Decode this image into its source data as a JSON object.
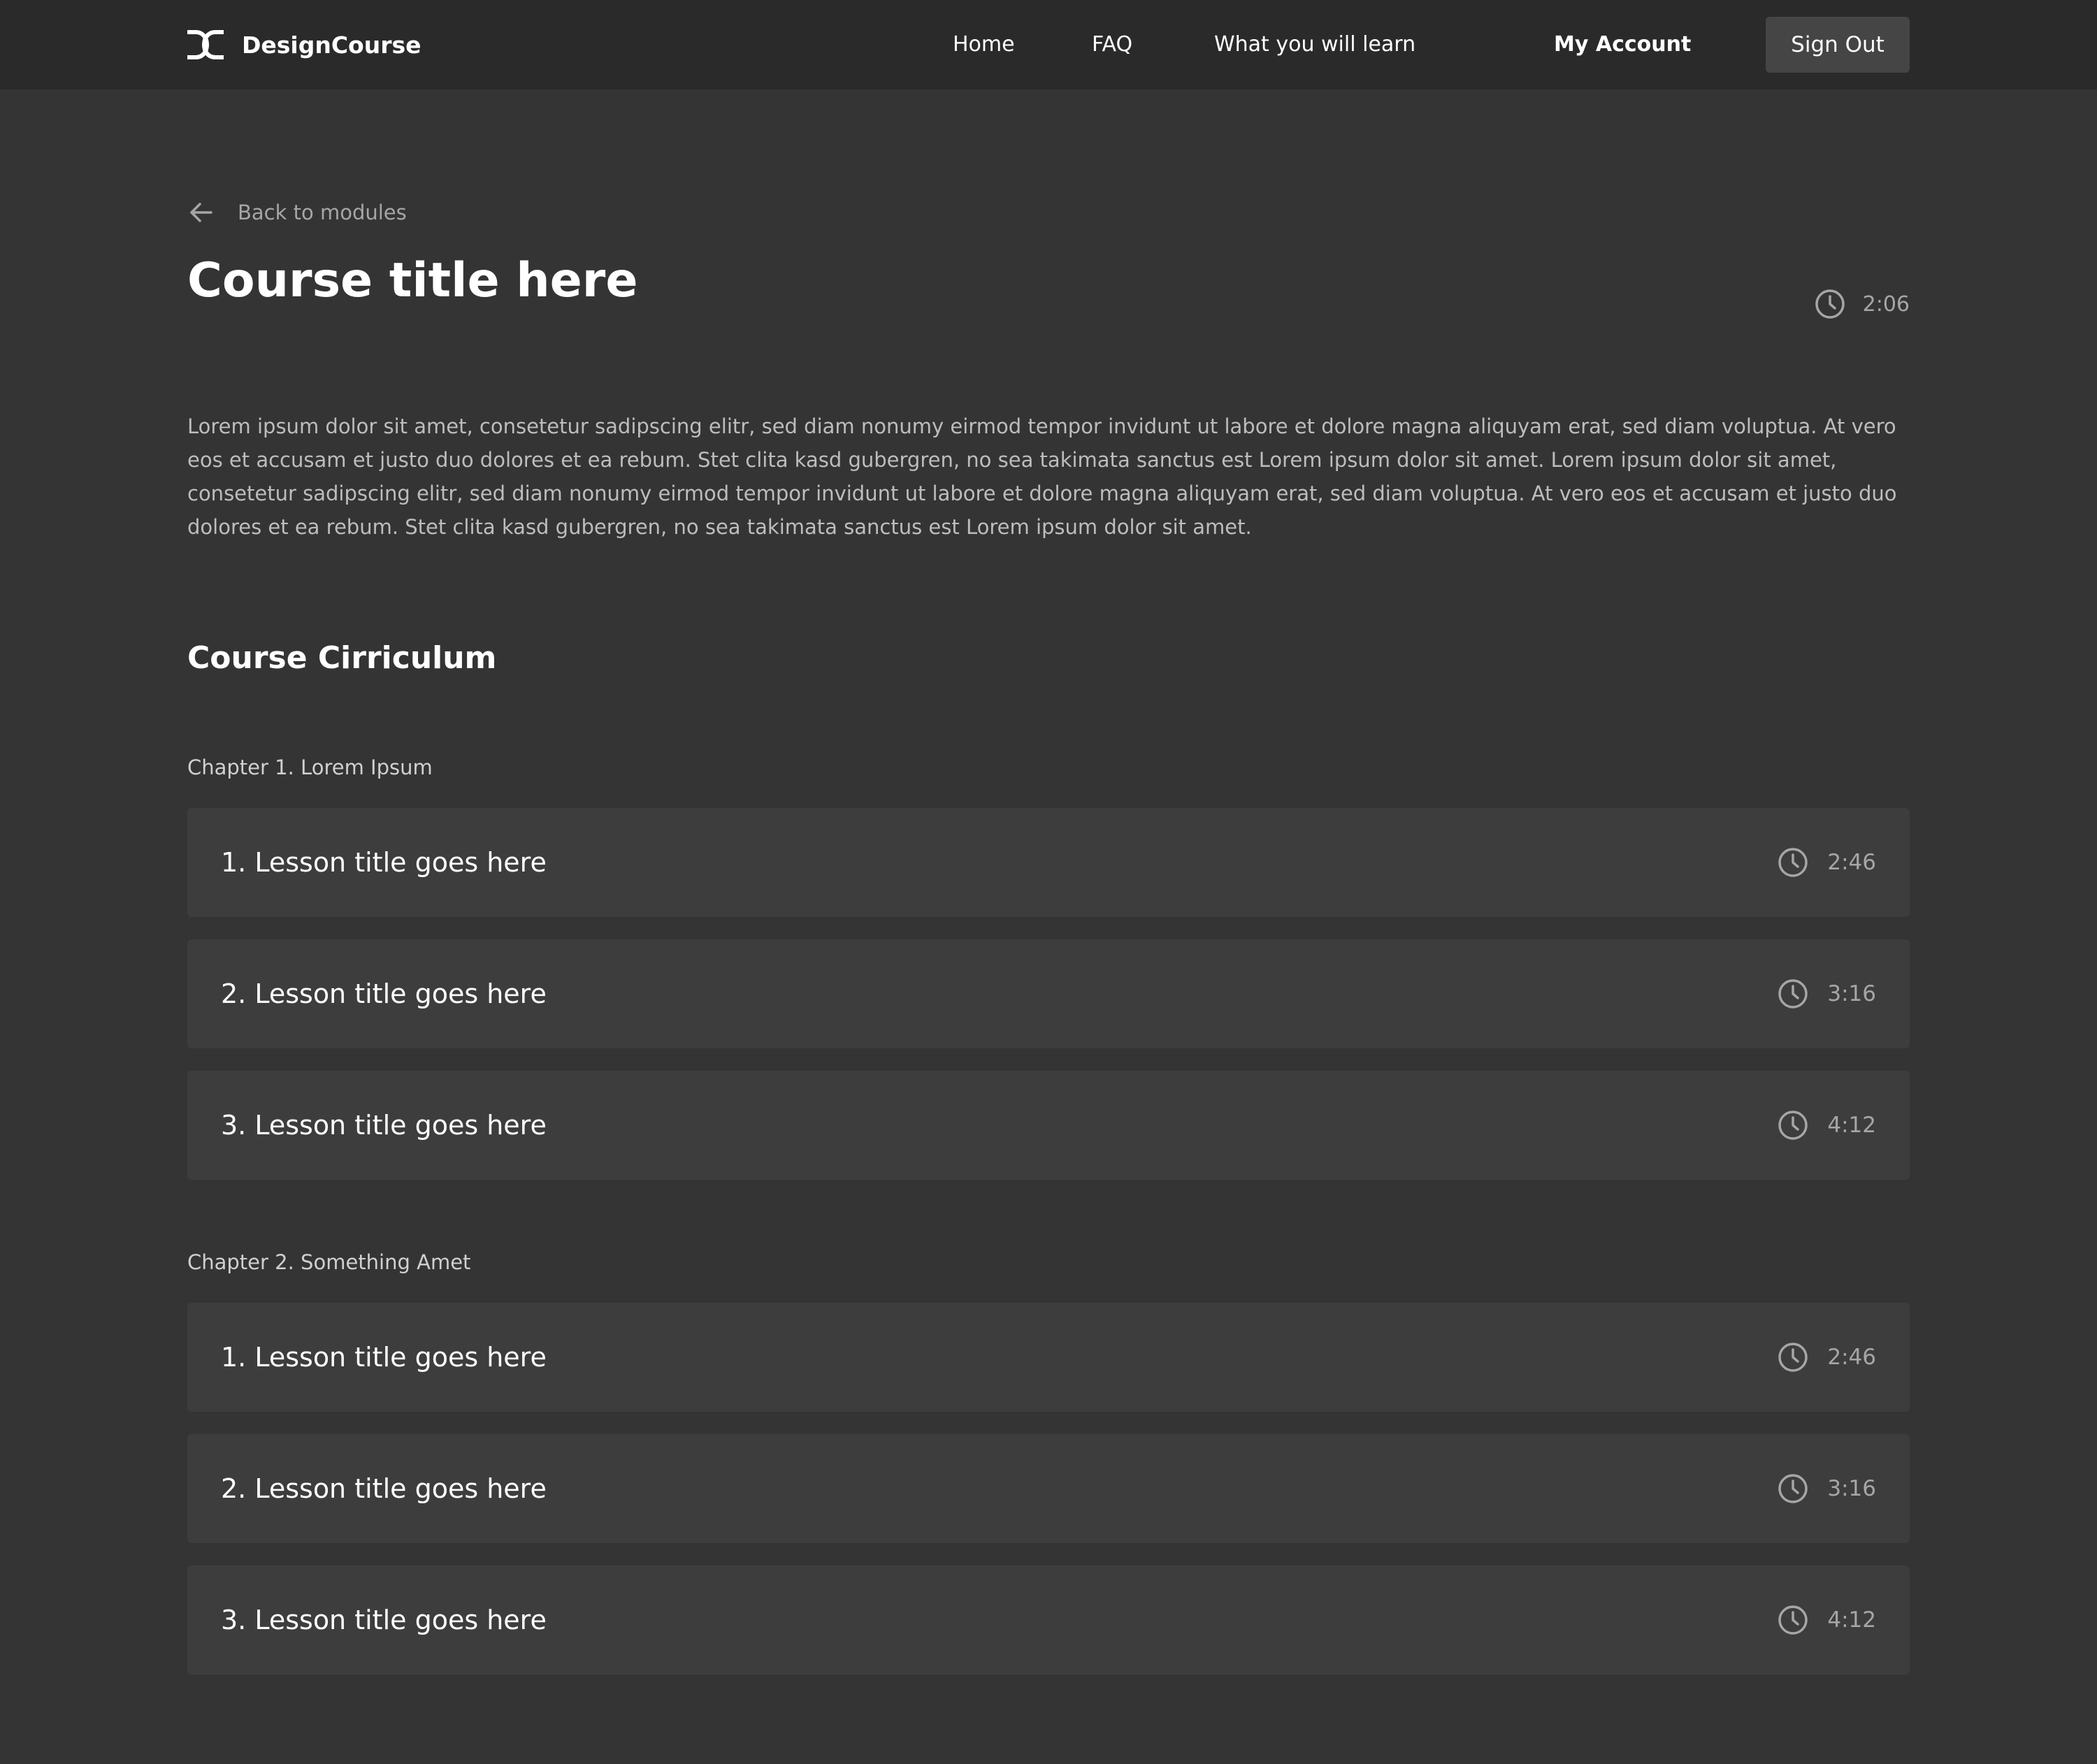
{
  "nav": {
    "brand_name": "DesignCourse",
    "brand_icon": "designcourse-logo-icon",
    "links": [
      "Home",
      "FAQ",
      "What you will learn",
      "My Account"
    ],
    "signout_label": "Sign Out",
    "colors": {
      "bar": "#2a2a2a",
      "button": "#454545"
    }
  },
  "back": {
    "label": "Back to modules",
    "icon": "arrow-left-icon"
  },
  "course": {
    "title": "Course title here",
    "duration": "2:06",
    "duration_icon": "clock-icon",
    "description": "Lorem ipsum dolor sit amet, consetetur sadipscing elitr, sed diam nonumy eirmod tempor invidunt ut labore et dolore magna aliquyam erat, sed diam voluptua. At vero eos et accusam et justo duo dolores et ea rebum. Stet clita kasd gubergren, no sea takimata sanctus est Lorem ipsum dolor sit amet. Lorem ipsum dolor sit amet, consetetur sadipscing elitr, sed diam nonumy eirmod tempor invidunt ut labore et dolore magna aliquyam erat, sed diam voluptua. At vero eos et accusam et justo duo dolores et ea rebum. Stet clita kasd gubergren, no sea takimata sanctus est Lorem ipsum dolor sit amet."
  },
  "curriculum": {
    "title": "Course Cirriculum",
    "chapters": [
      {
        "label": "Chapter 1. Lorem Ipsum",
        "lessons": [
          {
            "title": "1. Lesson title goes here",
            "duration": "2:46"
          },
          {
            "title": "2. Lesson title goes here",
            "duration": "3:16"
          },
          {
            "title": "3. Lesson title goes here",
            "duration": "4:12"
          }
        ]
      },
      {
        "label": "Chapter 2. Something Amet",
        "lessons": [
          {
            "title": "1. Lesson title goes here",
            "duration": "2:46"
          },
          {
            "title": "2. Lesson title goes here",
            "duration": "3:16"
          },
          {
            "title": "3. Lesson title goes here",
            "duration": "4:12"
          }
        ]
      }
    ]
  },
  "theme": {
    "page_background": "#343434",
    "row_background": "#3d3d3d",
    "muted_text": "#a6a6a6"
  }
}
